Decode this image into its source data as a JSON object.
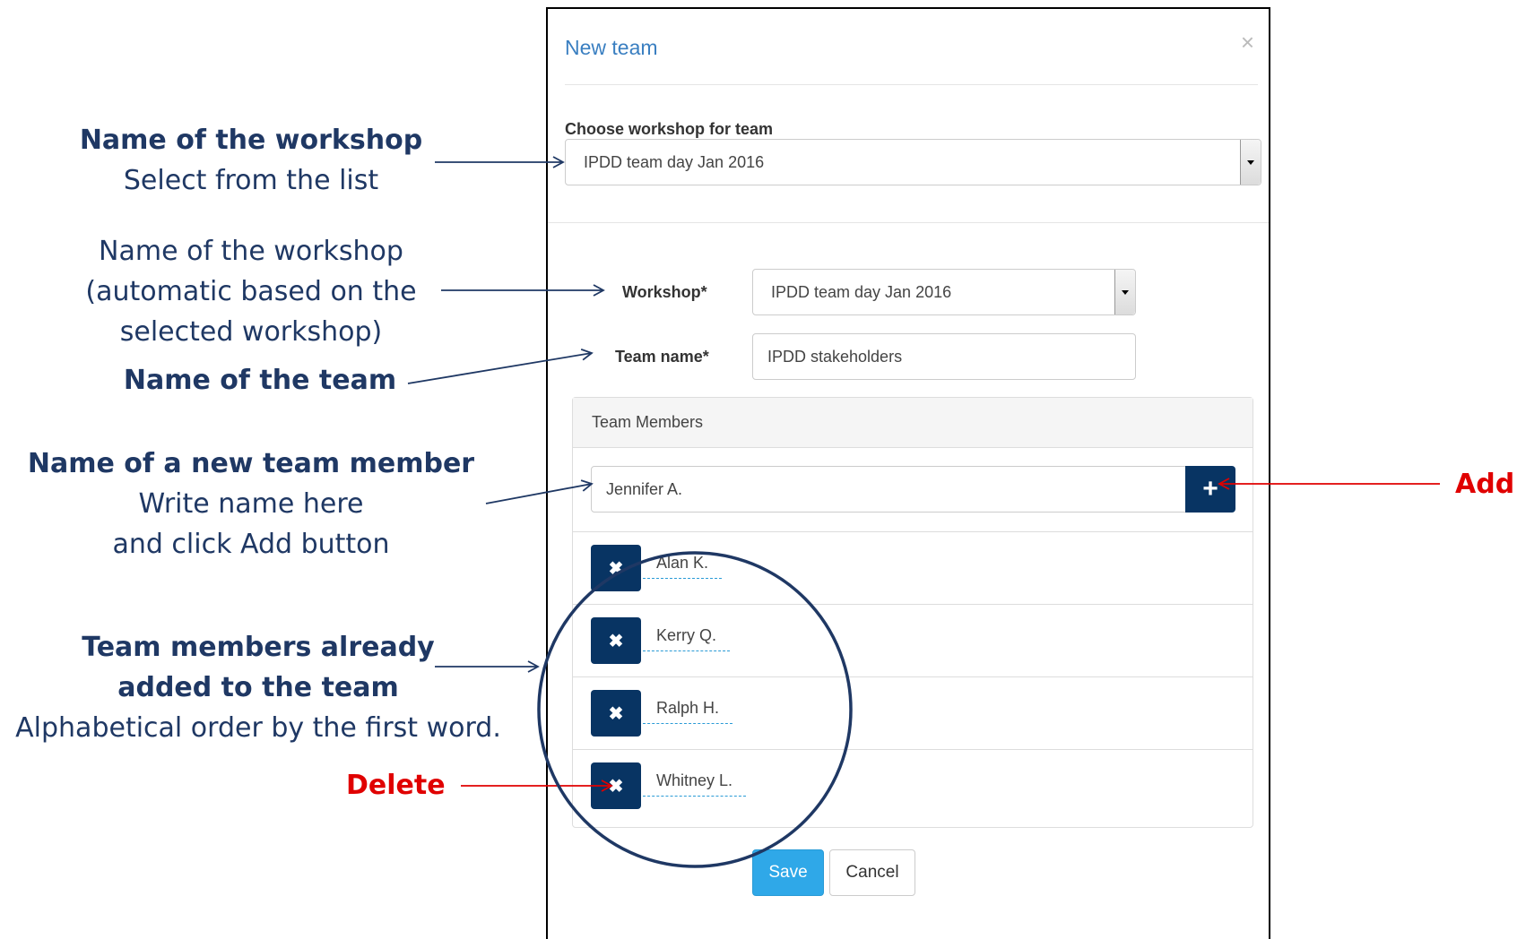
{
  "annotations": {
    "workshop_select_title": "Name of the workshop",
    "workshop_select_sub": "Select from the list",
    "workshop_auto_line1": "Name of the workshop",
    "workshop_auto_line2": "(automatic based on the",
    "workshop_auto_line3": "selected workshop)",
    "team_name": "Name of the team",
    "new_member_title": "Name of a new team member",
    "new_member_line1": "Write name here",
    "new_member_line2": "and click Add button",
    "members_title_line1": "Team members already",
    "members_title_line2": "added to the team",
    "members_sub": "Alphabetical order by the first word.",
    "delete": "Delete",
    "add": "Add"
  },
  "modal": {
    "title": "New team",
    "close": "×",
    "choose_label": "Choose workshop for team",
    "choose_value": "IPDD team day Jan 2016",
    "workshop_label": "Workshop*",
    "workshop_value": "IPDD team day Jan 2016",
    "team_name_label": "Team name*",
    "team_name_value": "IPDD stakeholders",
    "members_header": "Team Members",
    "new_member_value": "Jennifer A.",
    "add_icon": "+",
    "delete_icon": "✖",
    "members": [
      "Alan K.",
      "Kerry Q.",
      "Ralph H.",
      "Whitney L."
    ],
    "save_label": "Save",
    "cancel_label": "Cancel"
  },
  "colors": {
    "annotation_text": "#1f3864",
    "annotation_red": "#e00000",
    "title_blue": "#3a7fc1",
    "dark_button": "#083463",
    "save_button": "#2fa8e8"
  }
}
